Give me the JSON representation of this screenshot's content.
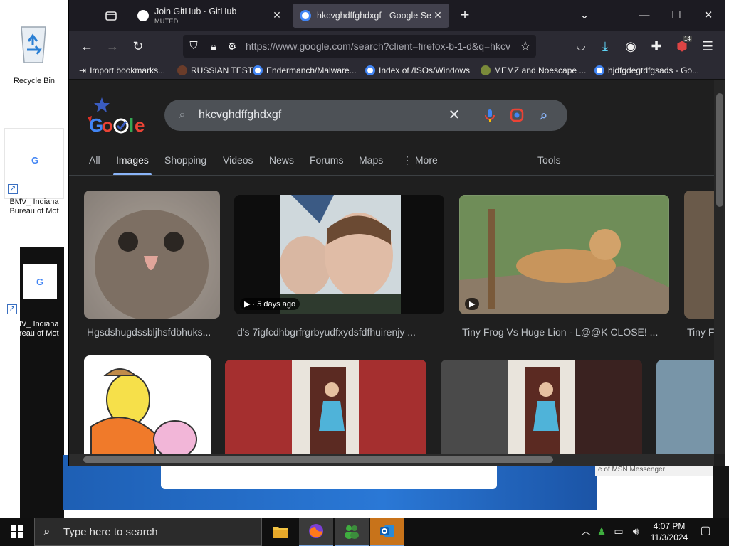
{
  "desktop": {
    "icons": [
      {
        "label": "Recycle Bin"
      },
      {
        "label_line1": "BMV_ Indiana",
        "label_line2": "Bureau of Mot"
      },
      {
        "label_line1": "BMV_ Indiana",
        "label_line2": "Bureau of Mot"
      }
    ],
    "background_window_text": "e of MSN Messenger"
  },
  "browser": {
    "tabs": [
      {
        "title": "Join GitHub · GitHub",
        "subtitle": "MUTED",
        "active": false
      },
      {
        "title": "hkcvghdffghdxgf - Google Sear",
        "active": true
      }
    ],
    "url": "https://www.google.com/search?client=firefox-b-1-d&q=hkcv",
    "extension_badge": "14",
    "bookmarks": [
      {
        "label": "Import bookmarks..."
      },
      {
        "label": "RUSSIAN TEST"
      },
      {
        "label": "Endermanch/Malware..."
      },
      {
        "label": "Index of /ISOs/Windows"
      },
      {
        "label": "MEMZ and Noescape ..."
      },
      {
        "label": "hjdfgdegtdfgsads - Go..."
      }
    ]
  },
  "google": {
    "query": "hkcvghdffghdxgf",
    "tabs": [
      {
        "label": "All",
        "active": false
      },
      {
        "label": "Images",
        "active": true
      },
      {
        "label": "Shopping",
        "active": false
      },
      {
        "label": "Videos",
        "active": false
      },
      {
        "label": "News",
        "active": false
      },
      {
        "label": "Forums",
        "active": false
      },
      {
        "label": "Maps",
        "active": false
      },
      {
        "label": "More",
        "active": false
      }
    ],
    "tools_label": "Tools",
    "results": [
      {
        "caption": "Hgsdshugdssbljhsfdbhuks..."
      },
      {
        "caption": "d's 7igfcdhbgrfrgrbyudfxydsfdfhuirenjy ...",
        "chip": "5 days ago"
      },
      {
        "caption": "Tiny Frog Vs Huge Lion - L@@K CLOSE! ..."
      },
      {
        "caption": "Tiny F"
      }
    ]
  },
  "taskbar": {
    "search_placeholder": "Type here to search",
    "time": "4:07 PM",
    "date": "11/3/2024"
  }
}
